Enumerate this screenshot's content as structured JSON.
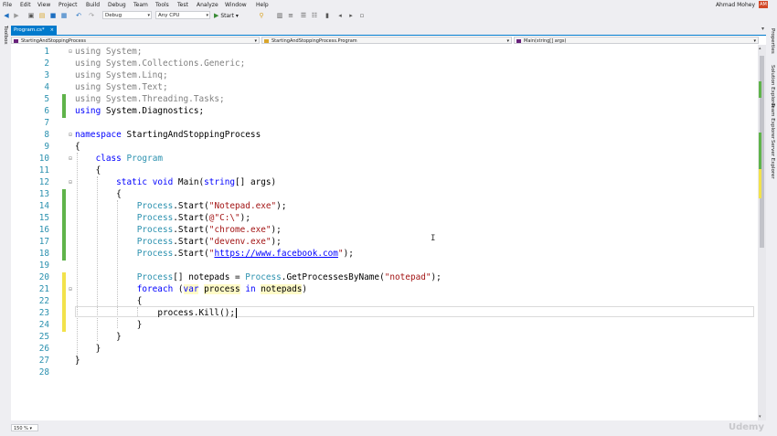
{
  "menu": {
    "items": [
      "File",
      "Edit",
      "View",
      "Project",
      "Build",
      "Debug",
      "Team",
      "Tools",
      "Test",
      "Analyze",
      "Window",
      "Help"
    ],
    "user": "Ahmad Mohey",
    "avatar": "AM"
  },
  "toolbar": {
    "config": "Debug",
    "platform": "Any CPU",
    "start_label": "Start"
  },
  "sidebar": {
    "left": "Toolbox",
    "right": [
      "Properties",
      "Solution Explorer",
      "Team Explorer",
      "Server Explorer"
    ]
  },
  "tabs": [
    {
      "label": "Program.cs*",
      "close": "×"
    }
  ],
  "navigation": {
    "project": "StartingAndStoppingProcess",
    "class": "StartingAndStoppingProcess.Program",
    "member": "Main(string[] args)"
  },
  "code": {
    "line_numbers": [
      "1",
      "2",
      "3",
      "4",
      "5",
      "6",
      "7",
      "8",
      "9",
      "10",
      "11",
      "12",
      "13",
      "14",
      "15",
      "16",
      "17",
      "18",
      "19",
      "20",
      "21",
      "22",
      "23",
      "24",
      "25",
      "26",
      "27",
      "28"
    ],
    "lines": [
      "using System;",
      "using System.Collections.Generic;",
      "using System.Linq;",
      "using System.Text;",
      "using System.Threading.Tasks;",
      "using System.Diagnostics;",
      "",
      "namespace StartingAndStoppingProcess",
      "{",
      "    class Program",
      "    {",
      "        static void Main(string[] args)",
      "        {",
      "            Process.Start(\"Notepad.exe\");",
      "            Process.Start(@\"C:\\\");",
      "            Process.Start(\"chrome.exe\");",
      "            Process.Start(\"devenv.exe\");",
      "            Process.Start(\"https://www.facebook.com\");",
      "",
      "            Process[] notepads = Process.GetProcessesByName(\"notepad\");",
      "            foreach (var process in notepads)",
      "            {",
      "                process.Kill();",
      "            }",
      "        }",
      "    }",
      "}",
      ""
    ]
  },
  "status": {
    "zoom": "150 %",
    "watermark": "Udemy"
  },
  "colors": {
    "accent": "#007acc",
    "keyword": "#0000ff",
    "type": "#2b91af",
    "string": "#a31515",
    "change_saved": "#5fb34a",
    "change_unsaved": "#f2e24b"
  }
}
